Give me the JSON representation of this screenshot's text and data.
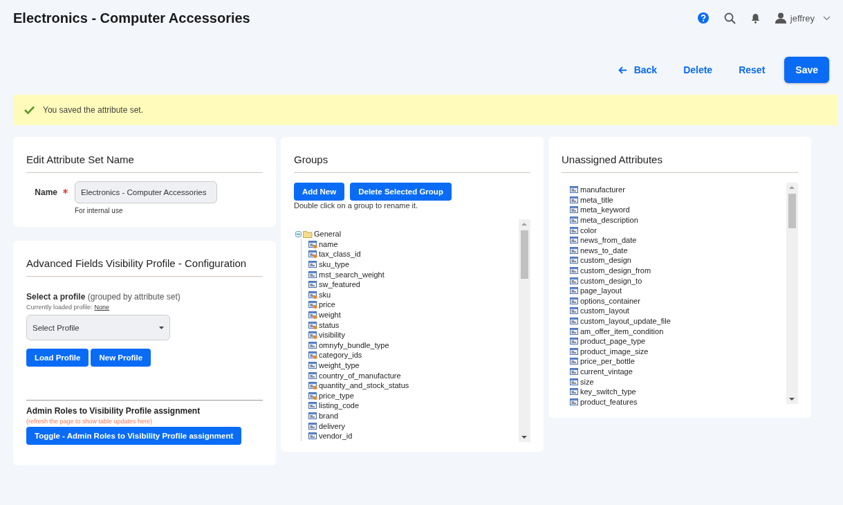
{
  "header": {
    "title": "Electronics - Computer Accessories",
    "user": "jeffrey"
  },
  "actions": [
    {
      "label": "Back",
      "kind": "back"
    },
    {
      "label": "Delete",
      "kind": "link"
    },
    {
      "label": "Reset",
      "kind": "link"
    },
    {
      "label": "Save",
      "kind": "primary"
    }
  ],
  "message": {
    "text": "You saved the attribute set."
  },
  "edit_name": {
    "title": "Edit Attribute Set Name",
    "label": "Name",
    "required": true,
    "value": "Electronics - Computer Accessories",
    "note": "For internal use"
  },
  "visibility": {
    "title": "Advanced Fields Visibility Profile - Configuration",
    "select_label": "**Select a profile** (grouped by attribute set)",
    "loaded_label": "Currently loaded profile:",
    "loaded_value": "None",
    "select": {
      "value": "Select Profile"
    },
    "buttons": [
      "Load Profile",
      "New Profile"
    ],
    "roles_title": "Admin Roles to Visibility Profile assignment",
    "roles_note": "(refresh the page to show table updates here)",
    "roles_button": "Toggle - Admin Roles to Visibility Profile assignment"
  },
  "groups": {
    "title": "Groups",
    "buttons": [
      "Add New",
      "Delete Selected Group"
    ],
    "hint": "Double click on a group to rename it.",
    "tree": [
      {
        "label": "General",
        "expanded": true,
        "children": [
          {
            "label": "name",
            "kind": "system"
          },
          {
            "label": "tax_class_id",
            "kind": "system"
          },
          {
            "label": "sku_type",
            "kind": "user"
          },
          {
            "label": "mst_search_weight",
            "kind": "user"
          },
          {
            "label": "sw_featured",
            "kind": "user"
          },
          {
            "label": "sku",
            "kind": "system"
          },
          {
            "label": "price",
            "kind": "system"
          },
          {
            "label": "weight",
            "kind": "system"
          },
          {
            "label": "status",
            "kind": "system"
          },
          {
            "label": "visibility",
            "kind": "system"
          },
          {
            "label": "omnyfy_bundle_type",
            "kind": "user"
          },
          {
            "label": "category_ids",
            "kind": "system"
          },
          {
            "label": "weight_type",
            "kind": "user"
          },
          {
            "label": "country_of_manufacture",
            "kind": "user"
          },
          {
            "label": "quantity_and_stock_status",
            "kind": "system"
          },
          {
            "label": "price_type",
            "kind": "system"
          },
          {
            "label": "listing_code",
            "kind": "user"
          },
          {
            "label": "brand",
            "kind": "user"
          },
          {
            "label": "delivery",
            "kind": "user"
          },
          {
            "label": "vendor_id",
            "kind": "user"
          }
        ]
      }
    ]
  },
  "unassigned": {
    "title": "Unassigned Attributes",
    "items": [
      "manufacturer",
      "meta_title",
      "meta_keyword",
      "meta_description",
      "color",
      "news_from_date",
      "news_to_date",
      "custom_design",
      "custom_design_from",
      "custom_design_to",
      "page_layout",
      "options_container",
      "custom_layout",
      "custom_layout_update_file",
      "am_offer_item_condition",
      "product_page_type",
      "product_image_size",
      "price_per_bottle",
      "current_vintage",
      "size",
      "key_switch_type",
      "product_features"
    ]
  }
}
